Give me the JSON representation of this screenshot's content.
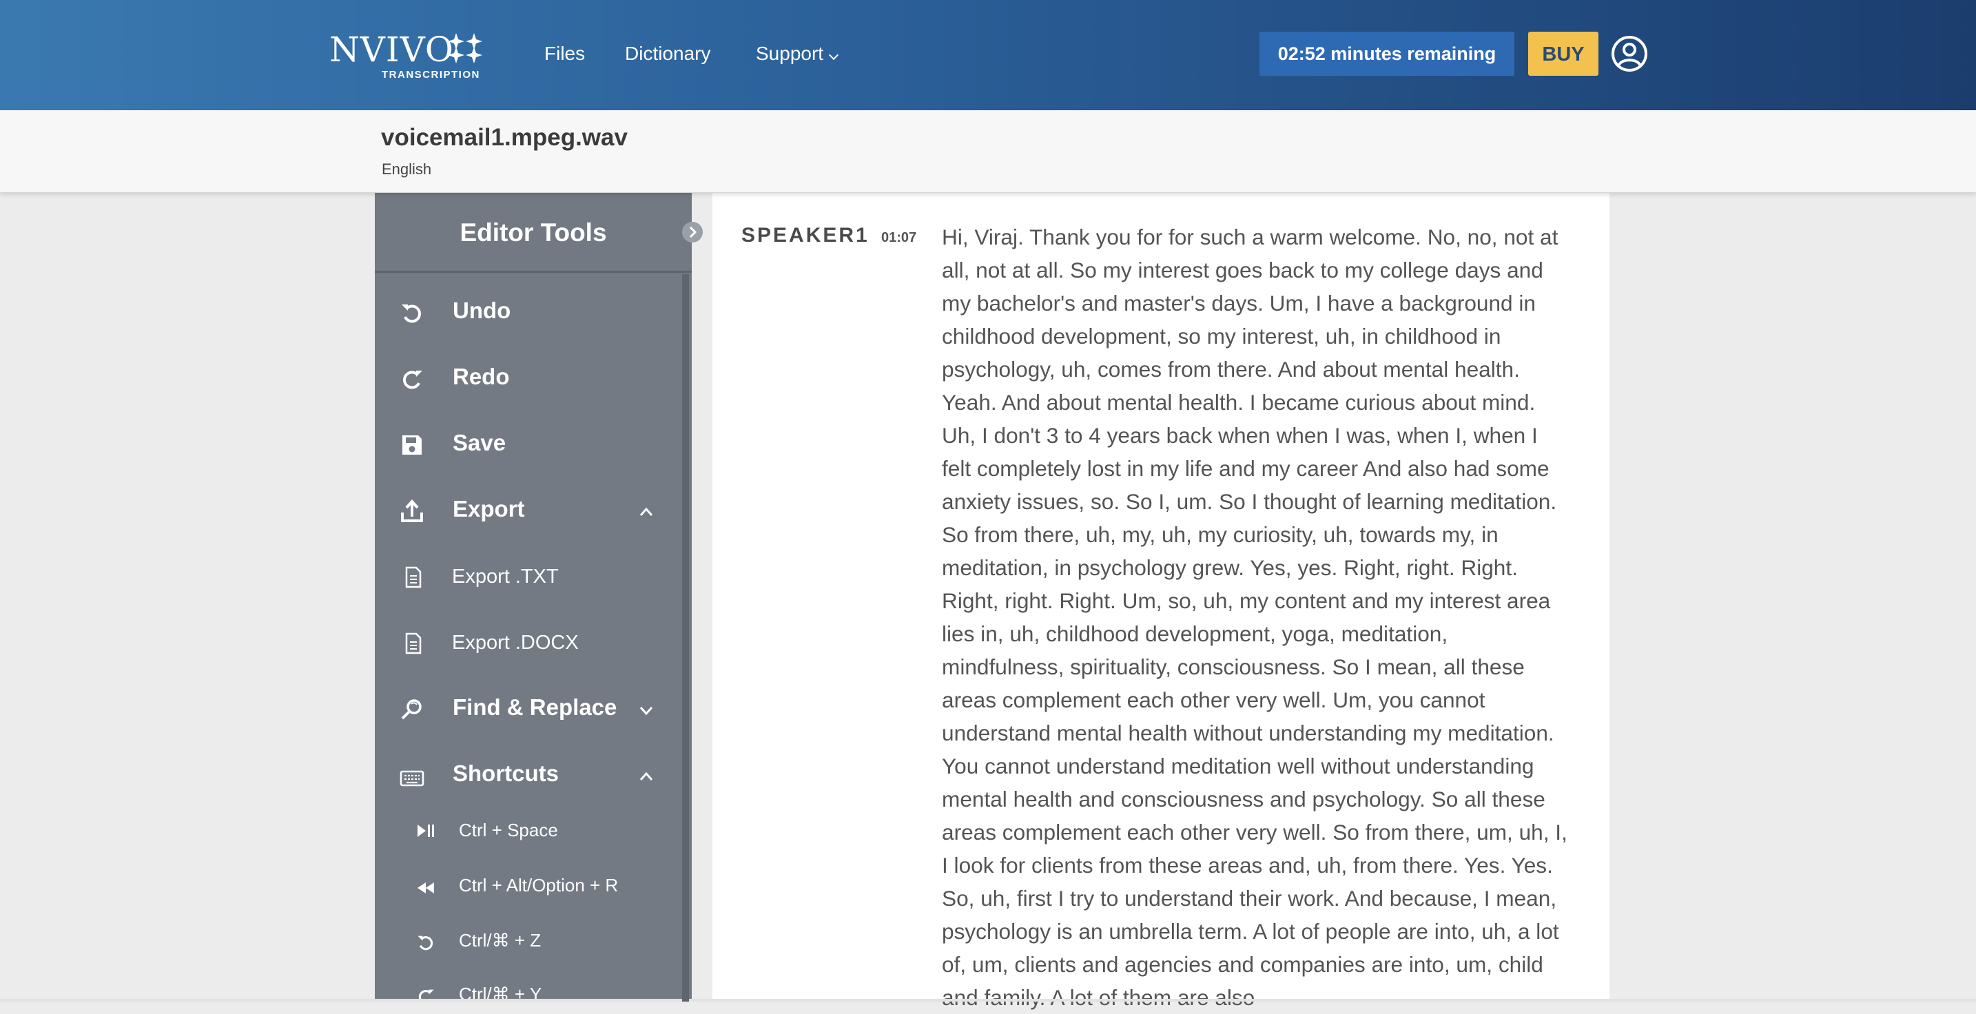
{
  "header": {
    "logo_text": "NVIVO",
    "logo_subtext": "TRANSCRIPTION",
    "nav": {
      "files": "Files",
      "dictionary": "Dictionary",
      "support": "Support"
    },
    "time_remaining": "02:52 minutes remaining",
    "buy_label": "BUY",
    "accent_color": "#2e6ab4",
    "buy_color": "#f2c14e"
  },
  "file": {
    "name": "voicemail1.mpeg.wav",
    "language": "English"
  },
  "sidebar": {
    "title": "Editor Tools",
    "items": [
      {
        "label": "Undo",
        "icon": "undo-icon"
      },
      {
        "label": "Redo",
        "icon": "redo-icon"
      },
      {
        "label": "Save",
        "icon": "save-icon"
      },
      {
        "label": "Export",
        "icon": "export-icon",
        "expanded": true
      },
      {
        "label": "Export .TXT",
        "icon": "document-icon"
      },
      {
        "label": "Export .DOCX",
        "icon": "document-icon"
      },
      {
        "label": "Find & Replace",
        "icon": "find-replace-icon",
        "expanded": false
      },
      {
        "label": "Shortcuts",
        "icon": "keyboard-icon",
        "expanded": true
      }
    ],
    "shortcuts": [
      {
        "label": "Ctrl + Space",
        "icon": "play-pause-icon"
      },
      {
        "label": "Ctrl + Alt/Option + R",
        "icon": "rewind-icon"
      },
      {
        "label": "Ctrl/⌘ + Z",
        "icon": "undo-icon"
      },
      {
        "label": "Ctrl/⌘ + Y",
        "icon": "redo-icon"
      }
    ]
  },
  "transcript": {
    "speaker": "SPEAKER1",
    "timestamp": "01:07",
    "text": "Hi, Viraj. Thank you for for such a warm welcome. No, no, not at all, not at all. So my interest goes back to my college days and my bachelor's and master's days. Um, I have a background in childhood development, so my interest, uh, in childhood in psychology, uh, comes from there. And about mental health. Yeah. And about mental health. I became curious about mind. Uh, I don't 3 to 4 years back when when I was, when I, when I felt completely lost in my life and my career And also had some anxiety issues, so. So I, um. So I thought of learning meditation. So from there, uh, my, uh, my curiosity, uh, towards my, in meditation, in psychology grew. Yes, yes. Right, right. Right. Right, right. Right. Um, so, uh, my content and my interest area lies in, uh, childhood development, yoga, meditation, mindfulness, spirituality, consciousness. So I mean, all these areas complement each other very well. Um, you cannot understand mental health without understanding my meditation. You cannot understand meditation well without understanding mental health and consciousness and psychology. So all these areas complement each other very well. So from there, um, uh, I, I look for clients from these areas and, uh, from there. Yes. Yes. So, uh, first I try to understand their work. And because, I mean, psychology is an umbrella term. A lot of people are into, uh, a lot of, um, clients and agencies and companies are into, um, child and family. A lot of them are also"
  }
}
